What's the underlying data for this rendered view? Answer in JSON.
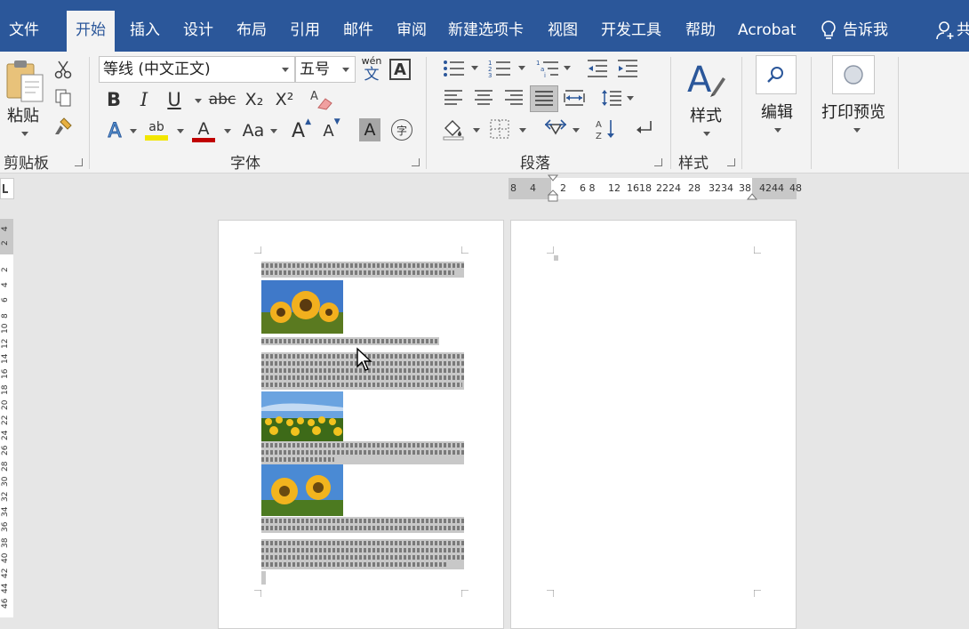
{
  "tabs": [
    {
      "label": "文件",
      "active": false
    },
    {
      "label": "开始",
      "active": true
    },
    {
      "label": "插入",
      "active": false
    },
    {
      "label": "设计",
      "active": false
    },
    {
      "label": "布局",
      "active": false
    },
    {
      "label": "引用",
      "active": false
    },
    {
      "label": "邮件",
      "active": false
    },
    {
      "label": "审阅",
      "active": false
    },
    {
      "label": "新建选项卡",
      "active": false
    },
    {
      "label": "视图",
      "active": false
    },
    {
      "label": "开发工具",
      "active": false
    },
    {
      "label": "帮助",
      "active": false
    },
    {
      "label": "Acrobat",
      "active": false
    }
  ],
  "tellme": {
    "label": "告诉我"
  },
  "share": {
    "label": "共"
  },
  "clipboard": {
    "paste_label": "粘贴",
    "group_label": "剪贴板"
  },
  "font": {
    "name": "等线 (中文正文)",
    "size": "五号",
    "group_label": "字体",
    "phonetic_top": "wén",
    "phonetic_bottom": "文",
    "border_char": "A",
    "bold": "B",
    "italic": "I",
    "underline": "U",
    "strike": "abc",
    "sub": "X₂",
    "sup": "X²",
    "clear": "A",
    "effects": "A",
    "highlight": "ab",
    "color": "A",
    "case": "Aa",
    "grow": "A",
    "shrink": "A",
    "shading": "A",
    "enclose": "字"
  },
  "paragraph": {
    "group_label": "段落"
  },
  "styles": {
    "label": "样式",
    "group_label": "样式"
  },
  "editing": {
    "label": "编辑"
  },
  "print": {
    "label": "打印预览"
  },
  "ruler": {
    "ticks": [
      "8",
      "4",
      "2",
      "6 8",
      "12",
      "1618",
      "2224",
      "28",
      "3234",
      "38",
      "4244",
      "48"
    ]
  },
  "vruler": {
    "ticks": [
      "4",
      "2",
      "2",
      "4",
      "6",
      "8",
      "10",
      "12",
      "14",
      "16",
      "18",
      "20",
      "22",
      "24",
      "26",
      "28",
      "30",
      "32",
      "34",
      "36",
      "38",
      "40",
      "42",
      "44",
      "46"
    ]
  },
  "colors": {
    "accent": "#2b579a",
    "highlight": "#f2e600",
    "font_color": "#c00000"
  }
}
